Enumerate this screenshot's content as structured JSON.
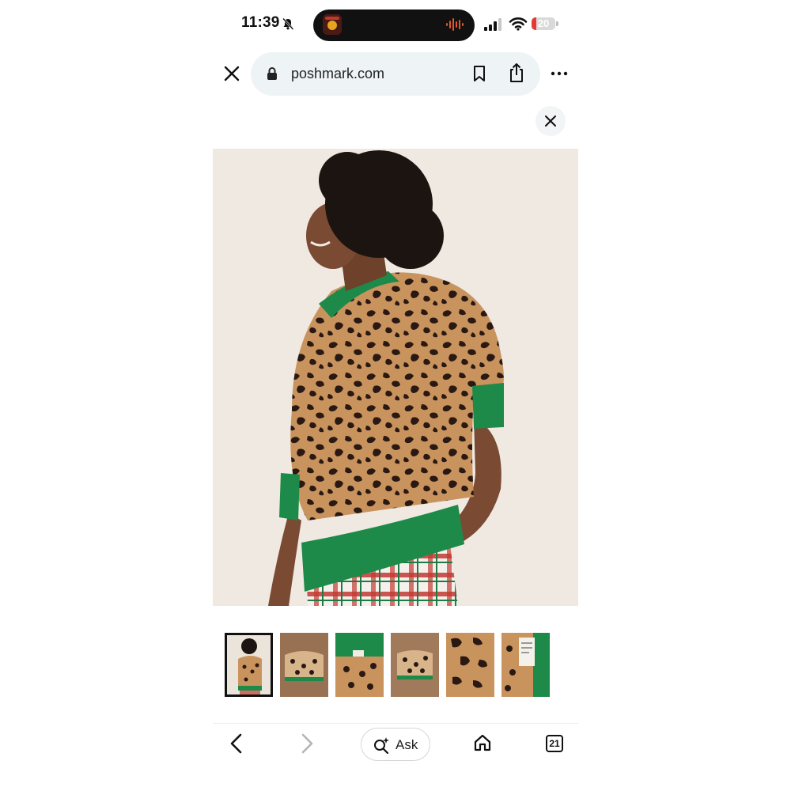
{
  "status_bar": {
    "time": "11:39",
    "battery": "20"
  },
  "browser": {
    "url": "poshmark.com"
  },
  "viewer": {
    "selected_thumbnail": 1
  },
  "bottom_nav": {
    "ask_label": "Ask",
    "tab_count": "21"
  },
  "colors": {
    "accent": "#1f8a4c",
    "battery_red": "#e53935"
  }
}
